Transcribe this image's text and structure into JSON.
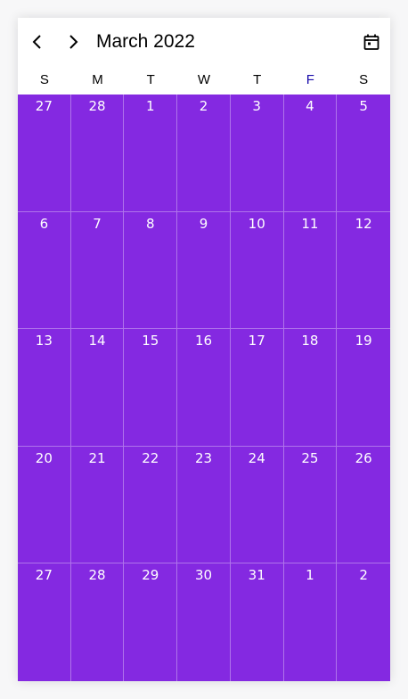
{
  "theme": {
    "accent": "#8429e1",
    "today_header_color": "#1a0dab"
  },
  "header": {
    "prev_icon": "chevron-left-icon",
    "next_icon": "chevron-right-icon",
    "title": "March 2022",
    "today_icon": "calendar-today-icon"
  },
  "weekdays": [
    "S",
    "M",
    "T",
    "W",
    "T",
    "F",
    "S"
  ],
  "highlight_weekday_index": 5,
  "weeks": [
    [
      "27",
      "28",
      "1",
      "2",
      "3",
      "4",
      "5"
    ],
    [
      "6",
      "7",
      "8",
      "9",
      "10",
      "11",
      "12"
    ],
    [
      "13",
      "14",
      "15",
      "16",
      "17",
      "18",
      "19"
    ],
    [
      "20",
      "21",
      "22",
      "23",
      "24",
      "25",
      "26"
    ],
    [
      "27",
      "28",
      "29",
      "30",
      "31",
      "1",
      "2"
    ]
  ]
}
